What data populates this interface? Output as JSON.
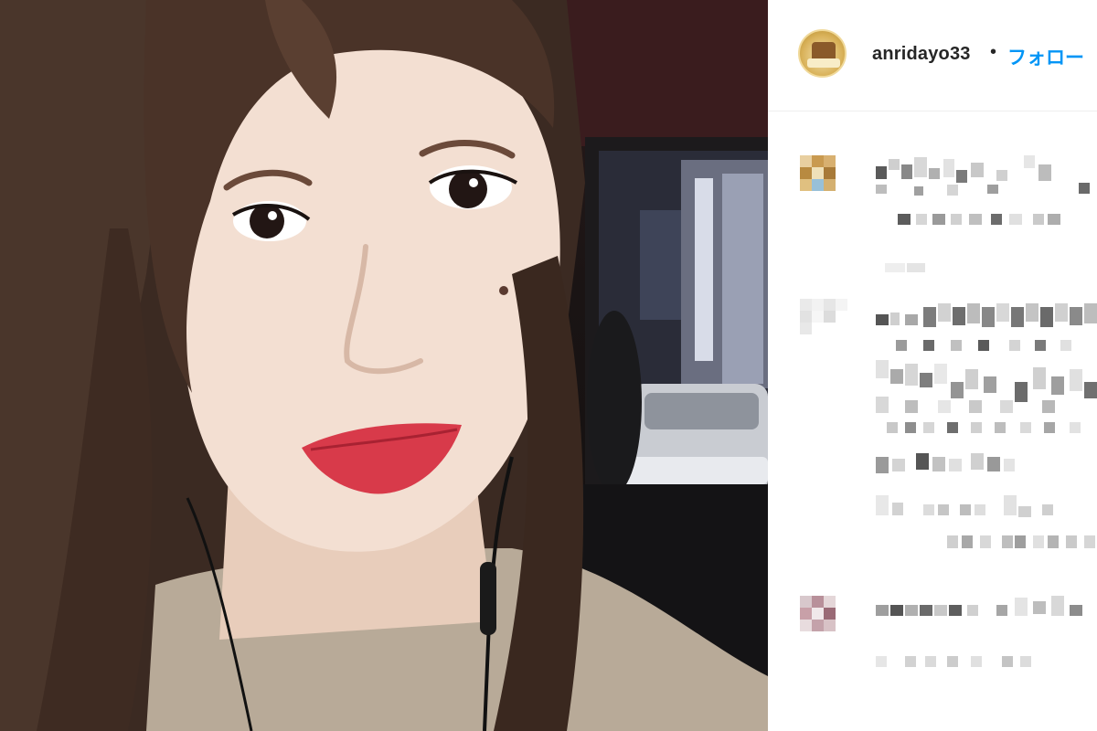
{
  "post": {
    "username": "anridayo33",
    "separator": "•",
    "follow_label": "フォロー"
  },
  "colors": {
    "follow_blue": "#0095f6",
    "text_dark": "#262626",
    "divider": "#efefef"
  },
  "icons": {
    "avatar": "profile-avatar"
  }
}
